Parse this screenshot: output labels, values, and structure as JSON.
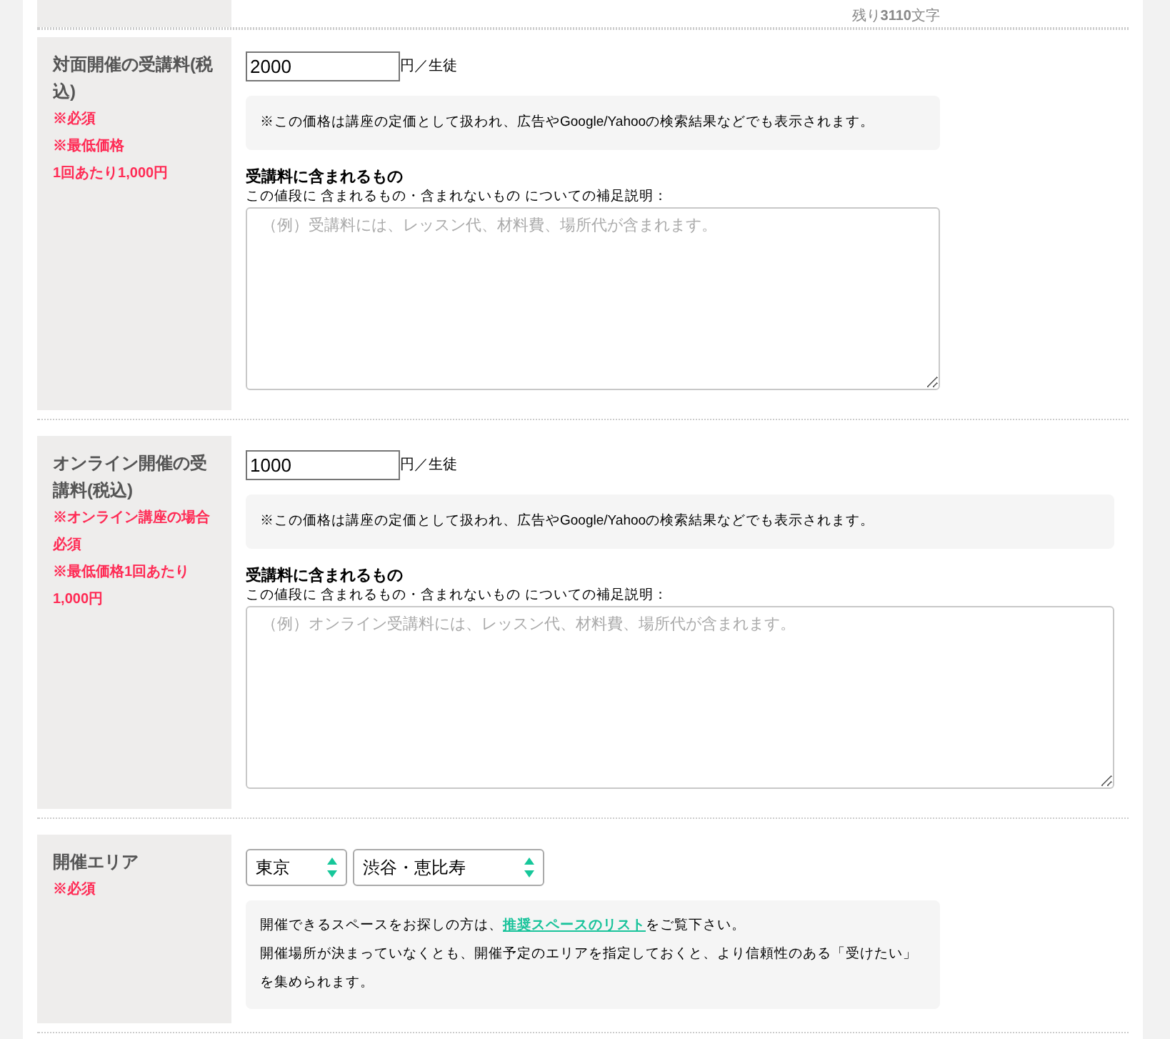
{
  "remaining": "残り**3110**文字",
  "sections": [
    {
      "kind": "price",
      "label": "対面開催の受講料(税込)",
      "notes": [
        "※必須",
        "※最低価格",
        "1回あたり1,000円"
      ],
      "value": "2000",
      "unit": "円／生徒",
      "notice": "※この価格は講座の定価として扱われ、広告やGoogle/Yahooの検索結果などでも表示されます。",
      "included_title": "受講料に含まれるもの",
      "included_desc": "この値段に 含まれるもの・含まれないもの についての補足説明：",
      "placeholder": "（例）受講料には、レッスン代、材料費、場所代が含まれます。"
    },
    {
      "kind": "price",
      "label": "オンライン開催の受講料(税込)",
      "notes": [
        "※オンライン講座の場合必須",
        "※最低価格1回あたり1,000円"
      ],
      "value": "1000",
      "unit": "円／生徒",
      "notice": "※この価格は講座の定価として扱われ、広告やGoogle/Yahooの検索結果などでも表示されます。",
      "included_title": "受講料に含まれるもの",
      "included_desc": "この値段に 含まれるもの・含まれないもの についての補足説明：",
      "placeholder": "（例）オンライン受講料には、レッスン代、材料費、場所代が含まれます。"
    },
    {
      "kind": "area",
      "label": "開催エリア",
      "notes": [
        "※必須"
      ],
      "selects": [
        "東京",
        "渋谷・恵比寿"
      ],
      "info_before": "開催できるスペースをお探しの方は、",
      "info_link": "推奨スペースのリスト",
      "info_after": "をご覧下さい。",
      "info_2": "開催場所が決まっていなくとも、開催予定のエリアを指定しておくと、より信頼性のある「受けたい」を集められます。"
    }
  ]
}
